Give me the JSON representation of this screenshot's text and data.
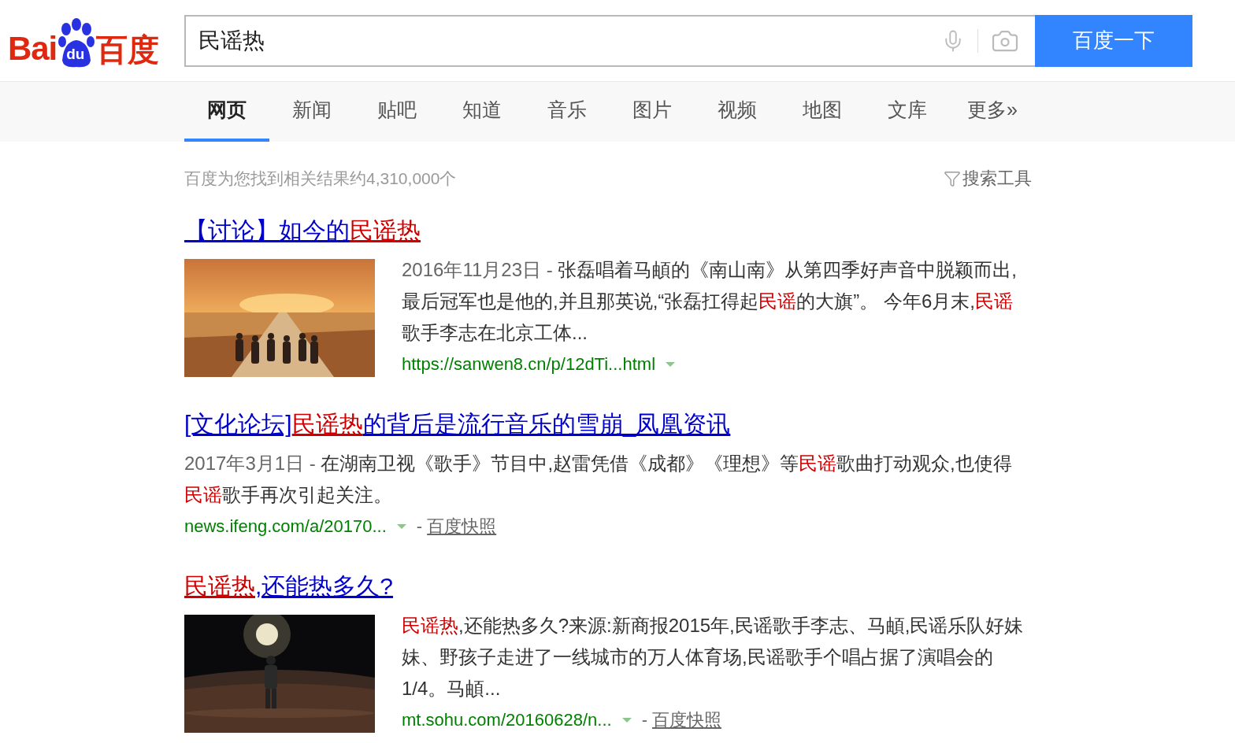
{
  "logo": {
    "left": "Bai",
    "paw": "du",
    "right": "百度"
  },
  "search": {
    "value": "民谣热",
    "button": "百度一下"
  },
  "tabs": [
    {
      "label": "网页",
      "selected": true
    },
    {
      "label": "新闻",
      "selected": false
    },
    {
      "label": "贴吧",
      "selected": false
    },
    {
      "label": "知道",
      "selected": false
    },
    {
      "label": "音乐",
      "selected": false
    },
    {
      "label": "图片",
      "selected": false
    },
    {
      "label": "视频",
      "selected": false
    },
    {
      "label": "地图",
      "selected": false
    },
    {
      "label": "文库",
      "selected": false
    },
    {
      "label": "更多»",
      "selected": false
    }
  ],
  "result_count": "百度为您找到相关结果约4,310,000个",
  "search_tools": "搜索工具",
  "results": [
    {
      "title": [
        {
          "text": "【讨论】如今的",
          "highlight": false
        },
        {
          "text": "民谣热",
          "highlight": true
        }
      ],
      "date": "2016年11月23日 - ",
      "snippet": [
        {
          "text": "张磊唱着马頔的《南山南》从第四季好声音中脱颖而出,最后冠军也是他的,并且那英说,“张磊扛得起",
          "highlight": false
        },
        {
          "text": "民谣",
          "highlight": true
        },
        {
          "text": "的大旗”。 今年6月末,",
          "highlight": false
        },
        {
          "text": "民谣",
          "highlight": true
        },
        {
          "text": "歌手李志在北京工体...",
          "highlight": false
        }
      ],
      "url": "https://sanwen8.cn/p/12dTi...html"
    },
    {
      "kind": "text",
      "title": [
        {
          "text": "[文化论坛]",
          "highlight": false
        },
        {
          "text": "民谣热",
          "highlight": true
        },
        {
          "text": "的背后是流行音乐的雪崩_凤凰资讯",
          "highlight": false
        }
      ],
      "date": "2017年3月1日 - ",
      "snippet": [
        {
          "text": "在湖南卫视《歌手》节目中,赵雷凭借《成都》《理想》等",
          "highlight": false
        },
        {
          "text": "民谣",
          "highlight": true
        },
        {
          "text": "歌曲打动观众,也使得",
          "highlight": false
        },
        {
          "text": "民谣",
          "highlight": true
        },
        {
          "text": "歌手再次引起关注。",
          "highlight": false
        }
      ],
      "url": "news.ifeng.com/a/20170...",
      "separator": "-",
      "snapshot": "百度快照"
    },
    {
      "title": [
        {
          "text": "民谣热",
          "highlight": true
        },
        {
          "text": ",还能热多久?",
          "highlight": false
        }
      ],
      "snippet": [
        {
          "text": "民谣热",
          "highlight": true
        },
        {
          "text": ",还能热多久?来源:新商报2015年,民谣歌手李志、马頔,民谣乐队好妹妹、野孩子走进了一线城市的万人体育场,民谣歌手个唱占据了演唱会的1/4。马頔...",
          "highlight": false
        }
      ],
      "url": "mt.sohu.com/20160628/n...",
      "separator": "-",
      "snapshot": "百度快照"
    }
  ]
}
